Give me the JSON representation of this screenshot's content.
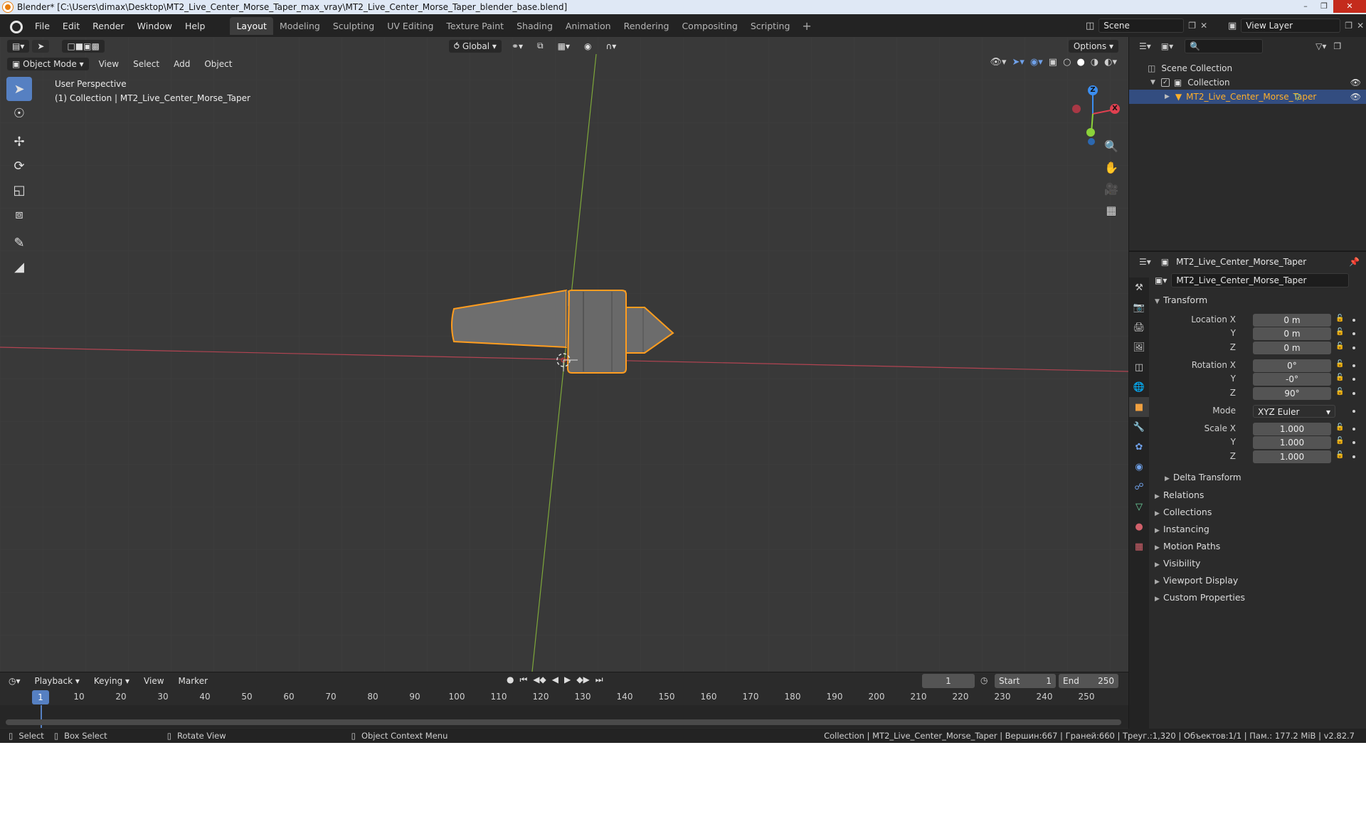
{
  "window": {
    "title": "Blender* [C:\\Users\\dimax\\Desktop\\MT2_Live_Center_Morse_Taper_max_vray\\MT2_Live_Center_Morse_Taper_blender_base.blend]"
  },
  "menu": {
    "items": [
      "File",
      "Edit",
      "Render",
      "Window",
      "Help"
    ]
  },
  "workspaces": [
    "Layout",
    "Modeling",
    "Sculpting",
    "UV Editing",
    "Texture Paint",
    "Shading",
    "Animation",
    "Rendering",
    "Compositing",
    "Scripting"
  ],
  "scene": {
    "name": "Scene"
  },
  "view_layer": {
    "name": "View Layer"
  },
  "viewport": {
    "transform_orientation": "Global",
    "options_label": "Options",
    "mode": "Object Mode",
    "menus": [
      "View",
      "Select",
      "Add",
      "Object"
    ],
    "perspective_label": "User Perspective",
    "collection_label": "(1) Collection | MT2_Live_Center_Morse_Taper",
    "gizmo_axes": {
      "x": "X",
      "y": "Y",
      "z": "Z"
    }
  },
  "timeline": {
    "menus": [
      "Playback",
      "Keying",
      "View",
      "Marker"
    ],
    "current_frame": "1",
    "start_label": "Start",
    "start_value": "1",
    "end_label": "End",
    "end_value": "250",
    "ruler": [
      "1",
      "10",
      "20",
      "30",
      "40",
      "50",
      "60",
      "70",
      "80",
      "90",
      "100",
      "110",
      "120",
      "130",
      "140",
      "150",
      "160",
      "170",
      "180",
      "190",
      "200",
      "210",
      "220",
      "230",
      "240",
      "250"
    ]
  },
  "statusbar": {
    "select": "Select",
    "box_select": "Box Select",
    "rotate_view": "Rotate View",
    "context_menu": "Object Context Menu",
    "info": "Collection | MT2_Live_Center_Morse_Taper | Вершин:667 | Граней:660 | Треуг.:1,320 | Объектов:1/1 | Пам.: 177.2 MiB | v2.82.7"
  },
  "outliner": {
    "scene_collection": "Scene Collection",
    "collection": "Collection",
    "object": "MT2_Live_Center_Morse_Taper"
  },
  "properties": {
    "object_name_header": "MT2_Live_Center_Morse_Taper",
    "object_name_field": "MT2_Live_Center_Morse_Taper",
    "transform_title": "Transform",
    "location_label": "Location X",
    "location": {
      "x": "0 m",
      "y": "0 m",
      "z": "0 m"
    },
    "rotation_label": "Rotation X",
    "rotation": {
      "x": "0°",
      "y": "-0°",
      "z": "90°"
    },
    "mode_label": "Mode",
    "mode_value": "XYZ Euler",
    "scale_label": "Scale X",
    "scale": {
      "x": "1.000",
      "y": "1.000",
      "z": "1.000"
    },
    "axis_y": "Y",
    "axis_z": "Z",
    "delta_transform": "Delta Transform",
    "sections": [
      "Relations",
      "Collections",
      "Instancing",
      "Motion Paths",
      "Visibility",
      "Viewport Display",
      "Custom Properties"
    ]
  },
  "colors": {
    "accent_blue": "#5680c2",
    "selection_orange": "#ffaf29",
    "axis_x_red": "#e04050",
    "axis_y_green": "#8bd23a",
    "axis_z_blue": "#3b8ef0"
  }
}
